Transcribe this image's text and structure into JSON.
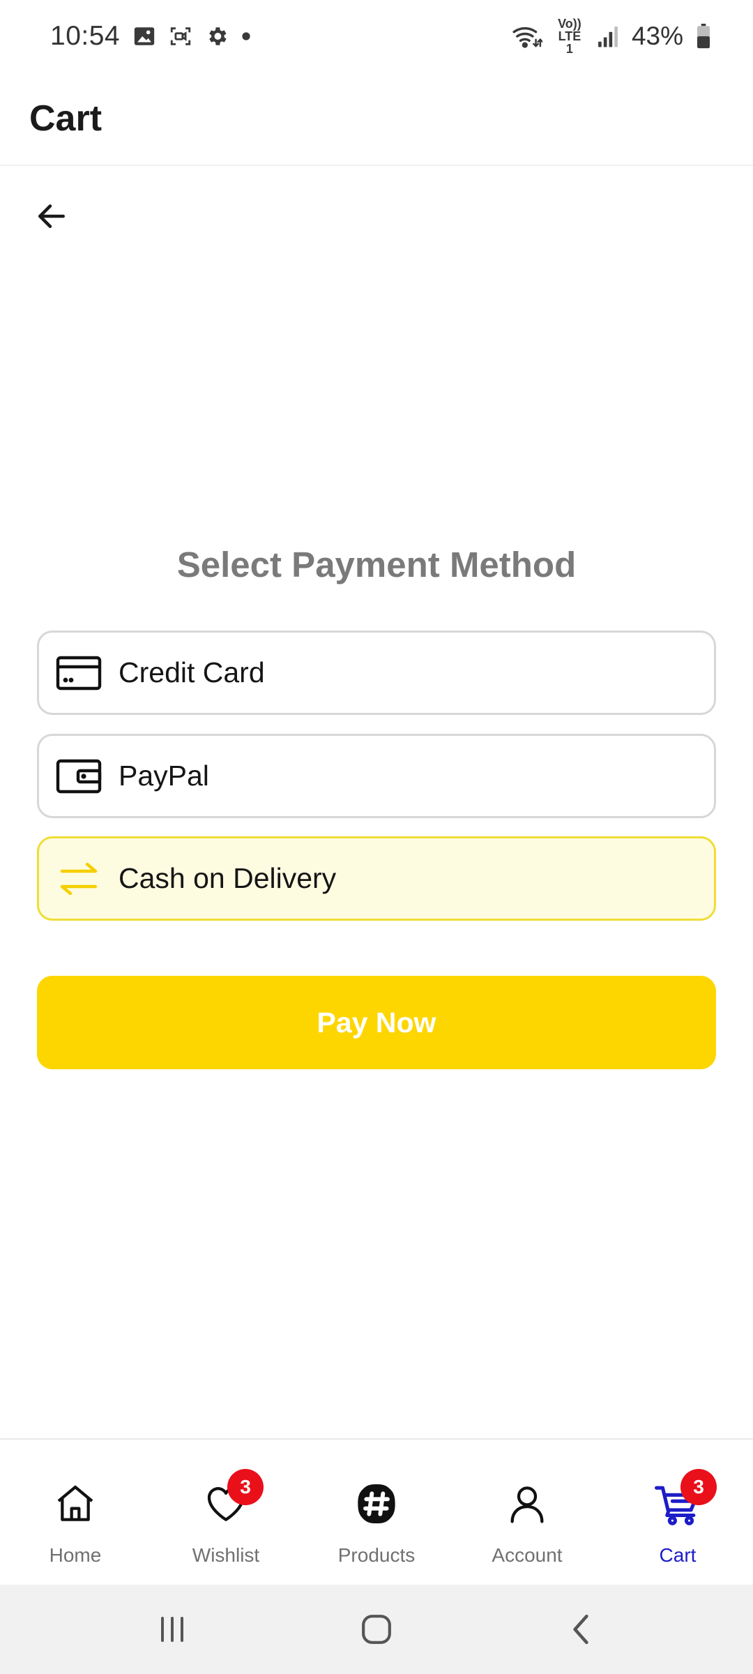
{
  "status_bar": {
    "time": "10:54",
    "battery": "43%",
    "network_label": "Vo)) LTE1",
    "icons": [
      "image-icon",
      "screen-record-icon",
      "settings-gear-icon",
      "dot-icon",
      "wifi-icon",
      "lte-icon",
      "signal-icon",
      "battery-icon"
    ]
  },
  "header": {
    "title": "Cart"
  },
  "main": {
    "back_icon": "back-arrow-icon",
    "section_title": "Select Payment Method",
    "payment_options": [
      {
        "label": "Credit Card",
        "icon": "credit-card-icon",
        "selected": false
      },
      {
        "label": "PayPal",
        "icon": "wallet-icon",
        "selected": false
      },
      {
        "label": "Cash on Delivery",
        "icon": "swap-arrows-icon",
        "selected": true
      }
    ],
    "pay_button_label": "Pay Now"
  },
  "bottom_nav": {
    "items": [
      {
        "label": "Home",
        "icon": "home-icon",
        "active": false
      },
      {
        "label": "Wishlist",
        "icon": "heart-icon",
        "badge": "3",
        "active": false
      },
      {
        "label": "Products",
        "icon": "products-icon",
        "active": false
      },
      {
        "label": "Account",
        "icon": "user-icon",
        "active": false
      },
      {
        "label": "Cart",
        "icon": "cart-icon",
        "badge": "3",
        "active": true
      }
    ]
  },
  "system_nav": {
    "buttons": [
      "recents-icon",
      "home-circle-icon",
      "back-chevron-icon"
    ]
  },
  "colors": {
    "accent_yellow": "#fdd600",
    "selected_bg": "#fdfce1",
    "selected_border": "#f0dd36",
    "active_nav": "#1c1cc8",
    "badge_red": "#e9101a",
    "title_gray": "#7a7a7a"
  }
}
